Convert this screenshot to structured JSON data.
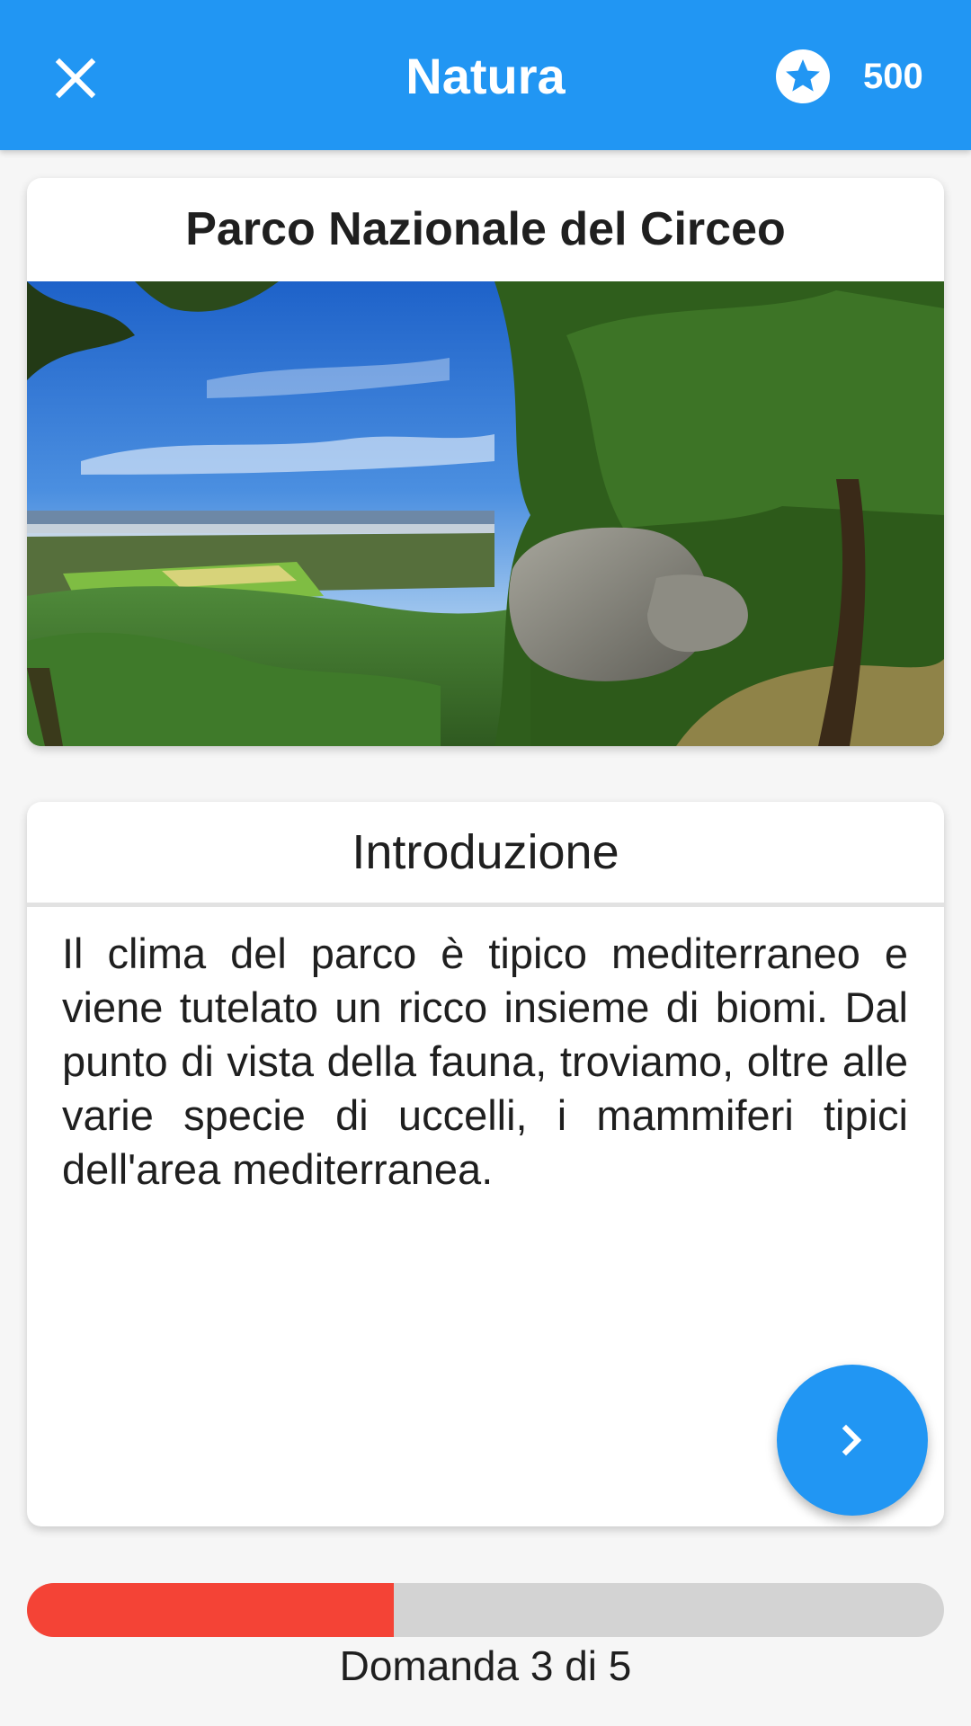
{
  "app_bar": {
    "title": "Natura",
    "close_icon": "close-icon",
    "score_icon": "star-icon",
    "score": "500",
    "color": "#2196f3"
  },
  "place_card": {
    "title": "Parco Nazionale del Circeo",
    "image_icon": "landscape-photo"
  },
  "intro_card": {
    "header": "Introduzione",
    "text": "Il clima del parco è tipico mediterraneo e viene tutelato un ricco insieme di biomi. Dal punto di vista della fauna, troviamo, oltre alle varie specie di uccelli, i mammiferi tipici dell'area mediterranea.",
    "next_icon": "chevron-right-icon"
  },
  "progress": {
    "label": "Domanda 3 di 5",
    "fraction": 0.4,
    "fill_color": "#f44336",
    "track_color": "#d3d3d3"
  }
}
